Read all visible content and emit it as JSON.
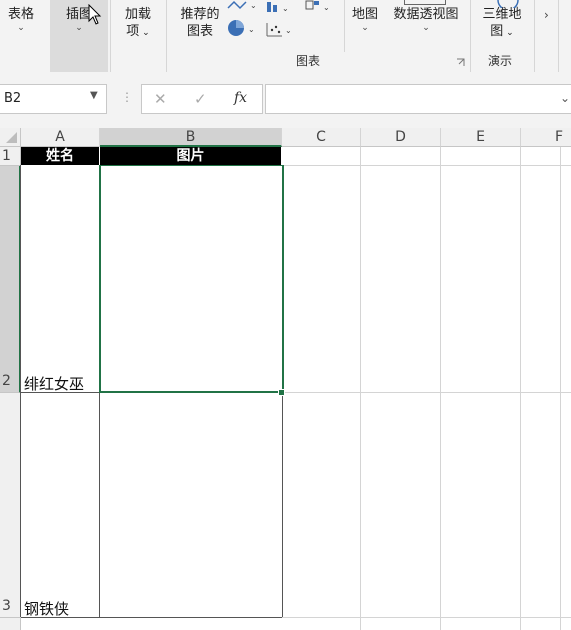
{
  "ribbon": {
    "table_btn": "表格",
    "illustrations_btn": "插图",
    "addins_btn_line1": "加载",
    "addins_btn_line2": "项",
    "recommended_charts_line1": "推荐的",
    "recommended_charts_line2": "图表",
    "map_btn": "地图",
    "pivot_chart_btn": "数据透视图",
    "three_d_map_line1": "三维地",
    "three_d_map_line2": "图",
    "charts_group_label": "图表",
    "tours_group_label": "演示"
  },
  "formula_bar": {
    "name_box_value": "B2",
    "fx_label": "fx",
    "cancel_symbol": "✕",
    "enter_symbol": "✓",
    "formula_value": ""
  },
  "sheet": {
    "columns": [
      "A",
      "B",
      "C",
      "D",
      "E",
      "F"
    ],
    "rows": [
      "1",
      "2",
      "3"
    ],
    "header_row": {
      "name": "姓名",
      "picture": "图片"
    },
    "cells": {
      "A2": "绯红女巫",
      "A3": "钢铁侠"
    },
    "selected_cell": "B2"
  },
  "colors": {
    "header_fill": "#000000",
    "header_text": "#ffffff",
    "selection_border": "#217346"
  }
}
